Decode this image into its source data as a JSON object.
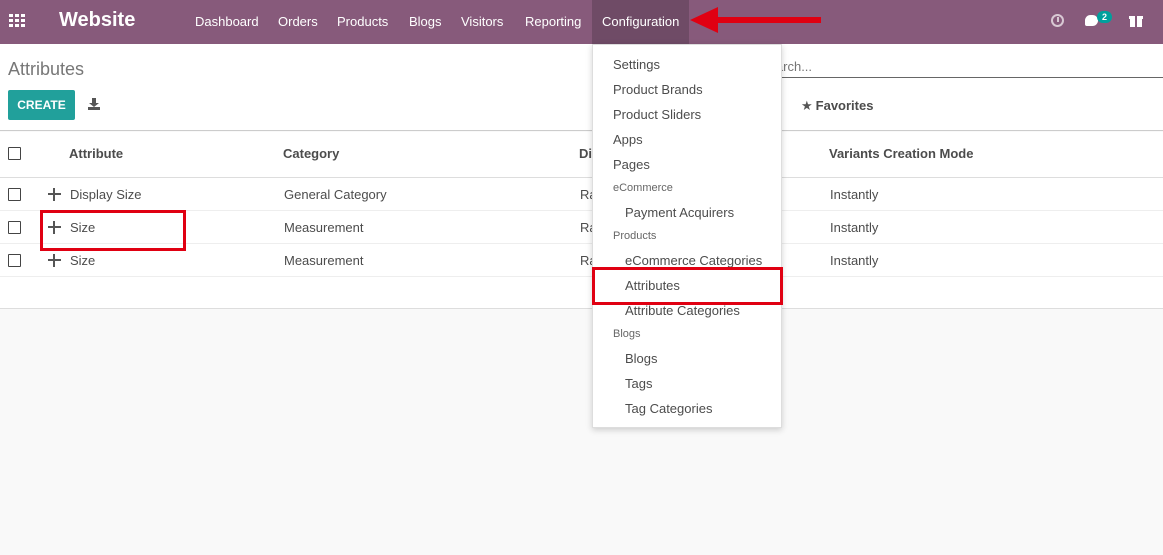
{
  "navbar": {
    "brand": "Website",
    "menu": [
      "Dashboard",
      "Orders",
      "Products",
      "Blogs",
      "Visitors",
      "Reporting",
      "Configuration"
    ],
    "active": "Configuration",
    "chat_count": "2"
  },
  "control_panel": {
    "title": "Attributes",
    "create_label": "CREATE",
    "search_placeholder": "Search...",
    "favorites_label": "Favorites"
  },
  "table": {
    "headers": [
      "Attribute",
      "Category",
      "Di",
      "Variants Creation Mode"
    ],
    "rows": [
      {
        "attribute": "Display Size",
        "category": "General Category",
        "display": "Ra",
        "mode": "Instantly"
      },
      {
        "attribute": "Size",
        "category": "Measurement",
        "display": "Ra",
        "mode": "Instantly"
      },
      {
        "attribute": "Size",
        "category": "Measurement",
        "display": "Ra",
        "mode": "Instantly"
      }
    ]
  },
  "dropdown": {
    "items": [
      {
        "kind": "item",
        "label": "Settings"
      },
      {
        "kind": "item",
        "label": "Product Brands"
      },
      {
        "kind": "item",
        "label": "Product Sliders"
      },
      {
        "kind": "item",
        "label": "Apps"
      },
      {
        "kind": "item",
        "label": "Pages"
      },
      {
        "kind": "header",
        "label": "eCommerce"
      },
      {
        "kind": "subitem",
        "label": "Payment Acquirers"
      },
      {
        "kind": "header",
        "label": "Products"
      },
      {
        "kind": "subitem",
        "label": "eCommerce Categories"
      },
      {
        "kind": "subitem",
        "label": "Attributes"
      },
      {
        "kind": "subitem",
        "label": "Attribute Categories"
      },
      {
        "kind": "header",
        "label": "Blogs"
      },
      {
        "kind": "subitem",
        "label": "Blogs"
      },
      {
        "kind": "subitem",
        "label": "Tags"
      },
      {
        "kind": "subitem",
        "label": "Tag Categories"
      }
    ]
  },
  "colors": {
    "navbar": "#875a7b",
    "primary_button": "#21a09b",
    "highlight_box": "#e00012"
  }
}
